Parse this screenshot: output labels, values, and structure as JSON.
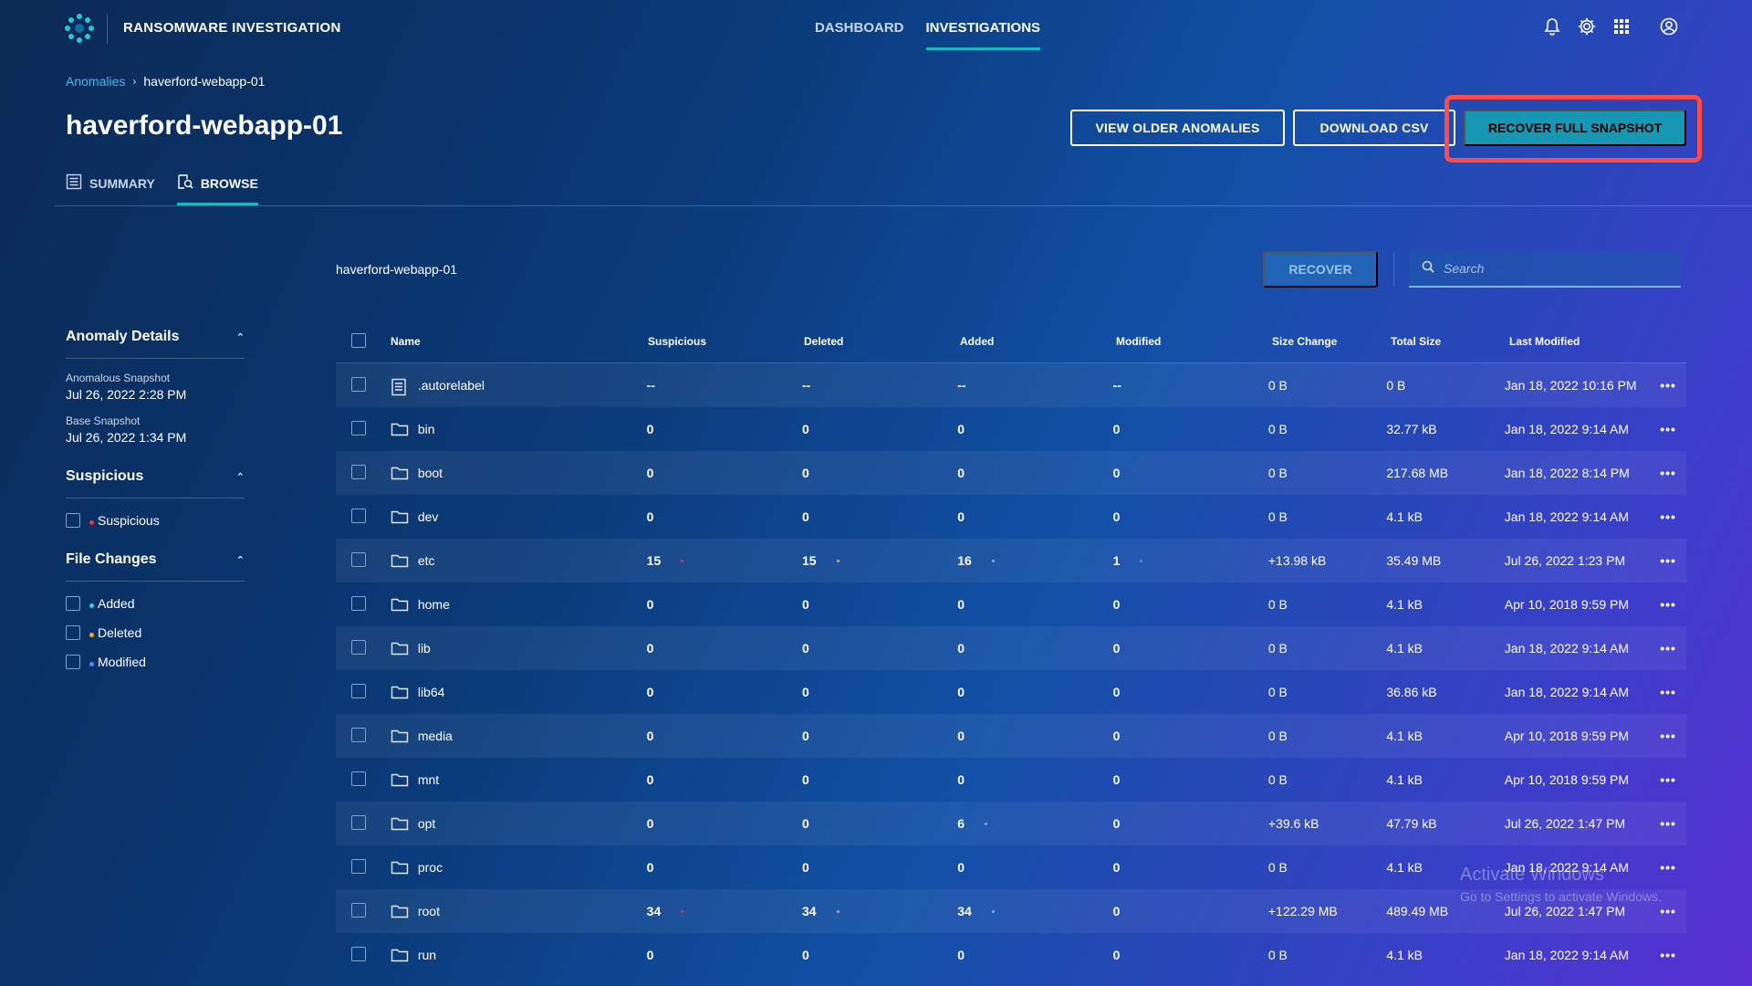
{
  "app": {
    "title": "RANSOMWARE INVESTIGATION"
  },
  "topnav": {
    "items": [
      {
        "label": "DASHBOARD"
      },
      {
        "label": "INVESTIGATIONS"
      }
    ],
    "active": "INVESTIGATIONS"
  },
  "top_icons": [
    "bell-icon",
    "gear-icon",
    "apps-grid-icon",
    "user-icon"
  ],
  "breadcrumb": {
    "link": "Anomalies",
    "current": "haverford-webapp-01"
  },
  "page": {
    "title": "haverford-webapp-01"
  },
  "actions": {
    "view_older": "VIEW OLDER ANOMALIES",
    "download_csv": "DOWNLOAD CSV",
    "recover_full": "RECOVER FULL SNAPSHOT",
    "highlight_color": "#ff4a4a"
  },
  "tabs": [
    {
      "label": "SUMMARY"
    },
    {
      "label": "BROWSE"
    }
  ],
  "active_tab": "BROWSE",
  "sidebar": {
    "anomaly": {
      "title": "Anomaly Details",
      "anomalous_label": "Anomalous Snapshot",
      "anomalous_value": "Jul 26, 2022 2:28 PM",
      "base_label": "Base Snapshot",
      "base_value": "Jul 26, 2022 1:34 PM"
    },
    "suspicious": {
      "title": "Suspicious",
      "options": [
        {
          "label": "Suspicious",
          "color": "#e8334a"
        }
      ]
    },
    "file_changes": {
      "title": "File Changes",
      "options": [
        {
          "label": "Added",
          "color": "#3fd0e0"
        },
        {
          "label": "Deleted",
          "color": "#f5a623"
        },
        {
          "label": "Modified",
          "color": "#4a8ef5"
        }
      ]
    }
  },
  "browse": {
    "path": "haverford-webapp-01",
    "recover_label": "RECOVER",
    "search_placeholder": "Search"
  },
  "table": {
    "columns": [
      "Name",
      "Suspicious",
      "Deleted",
      "Added",
      "Modified",
      "Size Change",
      "Total Size",
      "Last Modified"
    ],
    "rows": [
      {
        "icon": "file-icon",
        "name": ".autorelabel",
        "suspicious": "--",
        "deleted": "--",
        "added": "--",
        "modified": "--",
        "size_change": "0 B",
        "total_size": "0 B",
        "last_modified": "Jan 18, 2022 10:16 PM"
      },
      {
        "icon": "folder-icon",
        "name": "bin",
        "suspicious": "0",
        "deleted": "0",
        "added": "0",
        "modified": "0",
        "size_change": "0 B",
        "total_size": "32.77 kB",
        "last_modified": "Jan 18, 2022 9:14 AM"
      },
      {
        "icon": "folder-icon",
        "name": "boot",
        "suspicious": "0",
        "deleted": "0",
        "added": "0",
        "modified": "0",
        "size_change": "0 B",
        "total_size": "217.68 MB",
        "last_modified": "Jan 18, 2022 8:14 PM"
      },
      {
        "icon": "folder-icon",
        "name": "dev",
        "suspicious": "0",
        "deleted": "0",
        "added": "0",
        "modified": "0",
        "size_change": "0 B",
        "total_size": "4.1 kB",
        "last_modified": "Jan 18, 2022 9:14 AM"
      },
      {
        "icon": "folder-icon",
        "name": "etc",
        "suspicious": "15",
        "deleted": "15",
        "added": "16",
        "modified": "1",
        "size_change": "+13.98 kB",
        "total_size": "35.49 MB",
        "last_modified": "Jul 26, 2022 1:23 PM",
        "marks": true
      },
      {
        "icon": "folder-icon",
        "name": "home",
        "suspicious": "0",
        "deleted": "0",
        "added": "0",
        "modified": "0",
        "size_change": "0 B",
        "total_size": "4.1 kB",
        "last_modified": "Apr 10, 2018 9:59 PM"
      },
      {
        "icon": "folder-icon",
        "name": "lib",
        "suspicious": "0",
        "deleted": "0",
        "added": "0",
        "modified": "0",
        "size_change": "0 B",
        "total_size": "4.1 kB",
        "last_modified": "Jan 18, 2022 9:14 AM"
      },
      {
        "icon": "folder-icon",
        "name": "lib64",
        "suspicious": "0",
        "deleted": "0",
        "added": "0",
        "modified": "0",
        "size_change": "0 B",
        "total_size": "36.86 kB",
        "last_modified": "Jan 18, 2022 9:14 AM"
      },
      {
        "icon": "folder-icon",
        "name": "media",
        "suspicious": "0",
        "deleted": "0",
        "added": "0",
        "modified": "0",
        "size_change": "0 B",
        "total_size": "4.1 kB",
        "last_modified": "Apr 10, 2018 9:59 PM"
      },
      {
        "icon": "folder-icon",
        "name": "mnt",
        "suspicious": "0",
        "deleted": "0",
        "added": "0",
        "modified": "0",
        "size_change": "0 B",
        "total_size": "4.1 kB",
        "last_modified": "Apr 10, 2018 9:59 PM"
      },
      {
        "icon": "folder-icon",
        "name": "opt",
        "suspicious": "0",
        "deleted": "0",
        "added": "6",
        "modified": "0",
        "size_change": "+39.6 kB",
        "total_size": "47.79 kB",
        "last_modified": "Jul 26, 2022 1:47 PM",
        "marks": true
      },
      {
        "icon": "folder-icon",
        "name": "proc",
        "suspicious": "0",
        "deleted": "0",
        "added": "0",
        "modified": "0",
        "size_change": "0 B",
        "total_size": "4.1 kB",
        "last_modified": "Jan 18, 2022 9:14 AM"
      },
      {
        "icon": "folder-icon",
        "name": "root",
        "suspicious": "34",
        "deleted": "34",
        "added": "34",
        "modified": "0",
        "size_change": "+122.29 MB",
        "total_size": "489.49 MB",
        "last_modified": "Jul 26, 2022 1:47 PM",
        "marks": true
      },
      {
        "icon": "folder-icon",
        "name": "run",
        "suspicious": "0",
        "deleted": "0",
        "added": "0",
        "modified": "0",
        "size_change": "0 B",
        "total_size": "4.1 kB",
        "last_modified": "Jan 18, 2022 9:14 AM"
      }
    ]
  },
  "watermark": {
    "line1": "Activate Windows",
    "line2": "Go to Settings to activate Windows."
  }
}
